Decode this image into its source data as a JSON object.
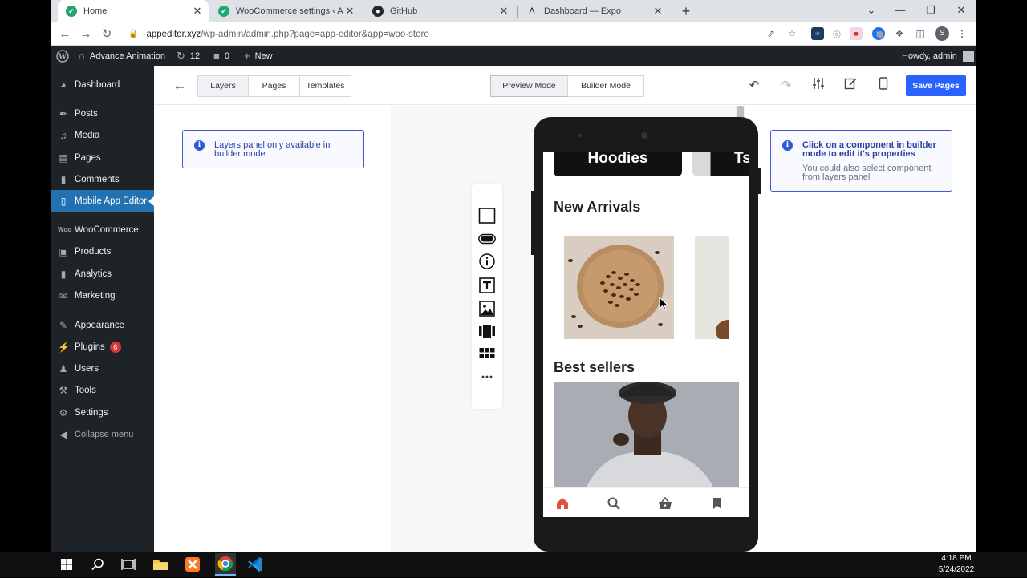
{
  "browser": {
    "tabs": [
      {
        "title": "Home",
        "active": true,
        "icon": "wordpress-icon"
      },
      {
        "title": "WooCommerce settings ‹ Advanc",
        "active": false,
        "icon": "wordpress-icon"
      },
      {
        "title": "GitHub",
        "active": false,
        "icon": "github-icon"
      },
      {
        "title": "Dashboard — Expo",
        "active": false,
        "icon": "expo-icon"
      }
    ],
    "url_host": "appeditor.xyz",
    "url_path": "/wp-admin/admin.php?page=app-editor&app=woo-store",
    "profile_initial": "S"
  },
  "adminbar": {
    "site_name": "Advance Animation",
    "updates_count": "12",
    "comments_count": "0",
    "new_label": "New",
    "greeting": "Howdy, admin"
  },
  "sidebar": {
    "items": [
      {
        "label": "Dashboard",
        "icon": "dashboard-icon"
      },
      {
        "label": "Posts",
        "icon": "pin-icon"
      },
      {
        "label": "Media",
        "icon": "media-icon"
      },
      {
        "label": "Pages",
        "icon": "pages-icon"
      },
      {
        "label": "Comments",
        "icon": "comment-icon"
      },
      {
        "label": "Mobile App Editor",
        "icon": "phone-icon",
        "current": true
      },
      {
        "label": "WooCommerce",
        "icon": "woo-icon"
      },
      {
        "label": "Products",
        "icon": "products-icon"
      },
      {
        "label": "Analytics",
        "icon": "analytics-icon"
      },
      {
        "label": "Marketing",
        "icon": "megaphone-icon"
      },
      {
        "label": "Appearance",
        "icon": "brush-icon"
      },
      {
        "label": "Plugins",
        "icon": "plug-icon",
        "badge": "6"
      },
      {
        "label": "Users",
        "icon": "users-icon"
      },
      {
        "label": "Tools",
        "icon": "wrench-icon"
      },
      {
        "label": "Settings",
        "icon": "settings-icon"
      },
      {
        "label": "Collapse menu",
        "icon": "collapse-icon"
      }
    ]
  },
  "editor": {
    "left_tabs": [
      "Layers",
      "Pages",
      "Templates"
    ],
    "mode_tabs": [
      "Preview Mode",
      "Builder Mode"
    ],
    "active_mode": "Preview Mode",
    "save_label": "Save Pages",
    "layers_notice": "Layers panel only available in builder mode",
    "props_notice": "Click on a component in builder mode to edit it's properties",
    "props_sub": "You could also select component from layers panel"
  },
  "phone": {
    "categories": [
      "Hoodies",
      "Ts"
    ],
    "new_arrivals_title": "New Arrivals",
    "best_sellers_title": "Best sellers"
  },
  "taskbar": {
    "time": "4:18 PM",
    "date": "5/24/2022"
  },
  "colors": {
    "wp_dark": "#1d2327",
    "wp_blue": "#2271b1",
    "save_blue": "#2962ff",
    "accent_red": "#e0523a"
  }
}
